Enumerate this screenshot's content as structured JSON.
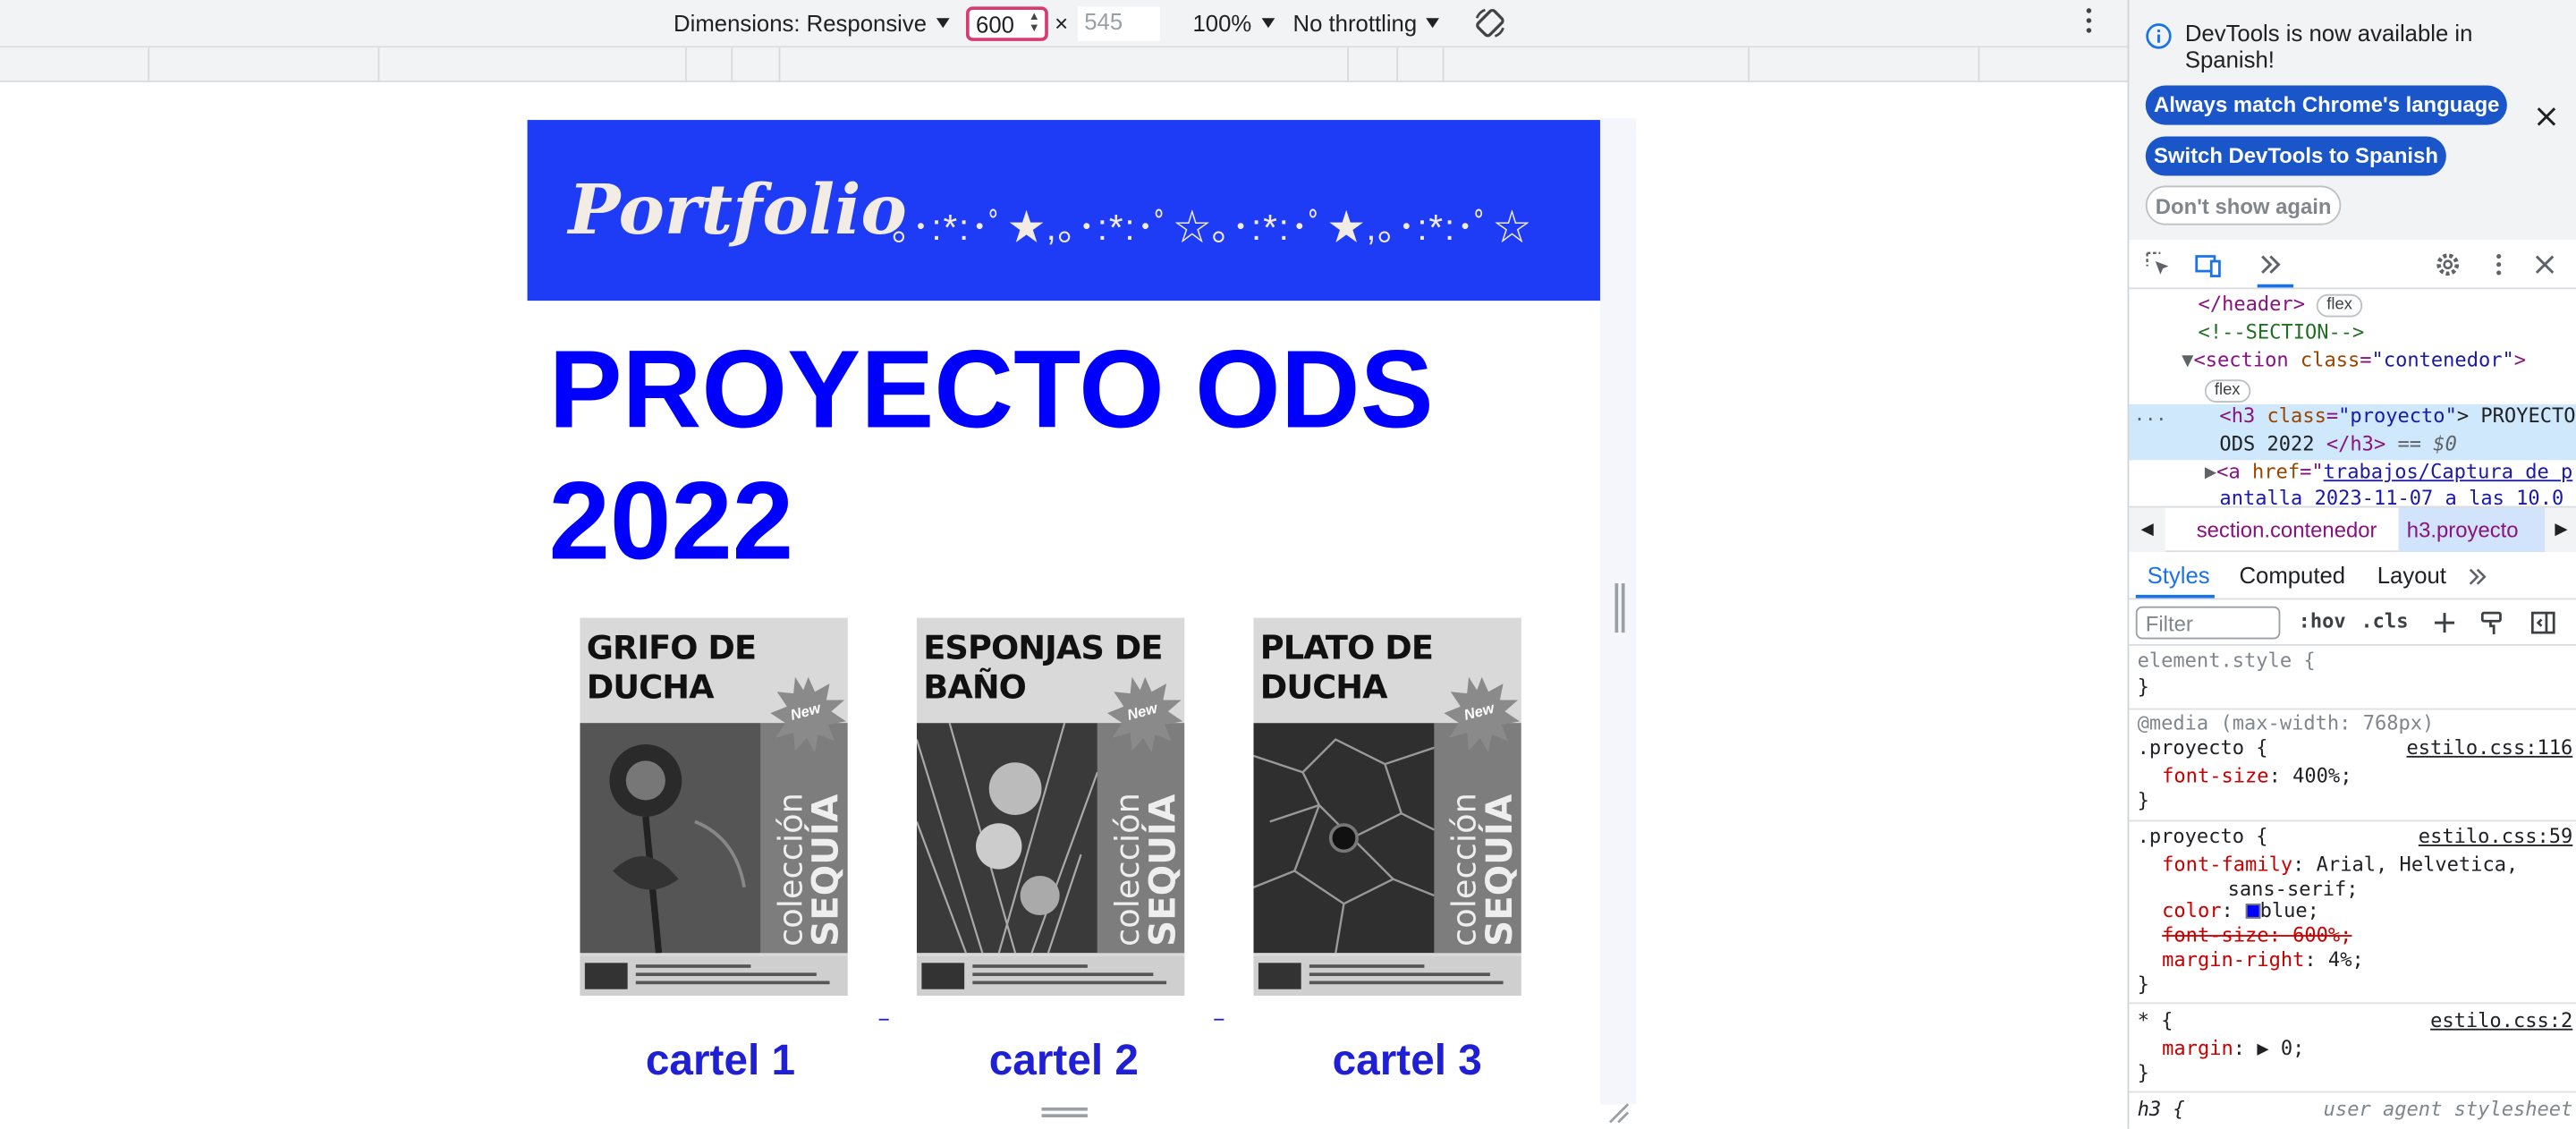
{
  "device_toolbar": {
    "dimensions_label": "Dimensions: Responsive",
    "width_value": "600",
    "times": "×",
    "height_value": "545",
    "zoom": "100%",
    "throttling": "No throttling"
  },
  "page": {
    "header_title": "Portfolio",
    "header_deco": "｡･:*:･ﾟ★,｡･:*:･ﾟ☆｡･:*:･ﾟ★,｡･:*:･ﾟ☆",
    "heading": "PROYECTO ODS 2022",
    "posters": [
      {
        "title": "GRIFO DE DUCHA",
        "badge": "New",
        "vertical_thin": "colección",
        "vertical_bold": "SEQUÍA"
      },
      {
        "title": "ESPONJAS DE BAÑO",
        "badge": "New",
        "vertical_thin": "colección",
        "vertical_bold": "SEQUÍA"
      },
      {
        "title": "PLATO DE DUCHA",
        "badge": "New",
        "vertical_thin": "colección",
        "vertical_bold": "SEQUÍA"
      }
    ],
    "links": [
      "cartel 1",
      "cartel 2",
      "cartel 3"
    ]
  },
  "devtools": {
    "banner": {
      "message": "DevTools is now available in Spanish!",
      "btn_match": "Always match Chrome's language",
      "btn_switch": "Switch DevTools to Spanish",
      "btn_dont_show": "Don't show again"
    },
    "dom": {
      "header_close": "</header>",
      "flex_badge": "flex",
      "comment": "<!--SECTION-->",
      "section_open_tag": "<section ",
      "section_attr": "class",
      "section_val": "\"contenedor\"",
      "section_close_bracket": ">",
      "h3_open": "<h3 ",
      "h3_attr": "class",
      "h3_val": "\"proyecto\"",
      "h3_text_1": "> PROYECTO",
      "h3_text_2": "ODS 2022 ",
      "h3_close": "</h3>",
      "h3_eq": " == $0",
      "ellipsis": "...",
      "a_open": "<a ",
      "a_attr": "href",
      "a_val_1": "trabajos/Captura de p",
      "a_val_2": "antalla 2023-11-07 a las 10.0"
    },
    "breadcrumbs": {
      "section": "section.contenedor",
      "current": "h3.proyecto"
    },
    "tabs": [
      "Styles",
      "Computed",
      "Layout"
    ],
    "filter": {
      "placeholder": "Filter",
      "hov": ":hov",
      "cls": ".cls"
    },
    "rules": {
      "element_style": "element.style {",
      "close": "}",
      "media": "@media (max-width: 768px)",
      "proyecto_sel": ".proyecto {",
      "src1": "estilo.css:116",
      "font_size_prop": "font-size",
      "font_size_400": ": 400%;",
      "src2": "estilo.css:59",
      "font_family_prop": "font-family",
      "font_family_val": ": Arial, Helvetica,",
      "font_family_val2": "sans-serif;",
      "color_prop": "color",
      "color_val": "blue;",
      "font_size_600": "font-size: 600%;",
      "margin_right_prop": "margin-right",
      "margin_right_val": ": 4%;",
      "star_sel": "* {",
      "src3": "estilo.css:2",
      "margin_prop": "margin",
      "margin_val": ": ▶ 0;",
      "h3_sel": "h3 {",
      "ua": "user agent stylesheet"
    }
  }
}
